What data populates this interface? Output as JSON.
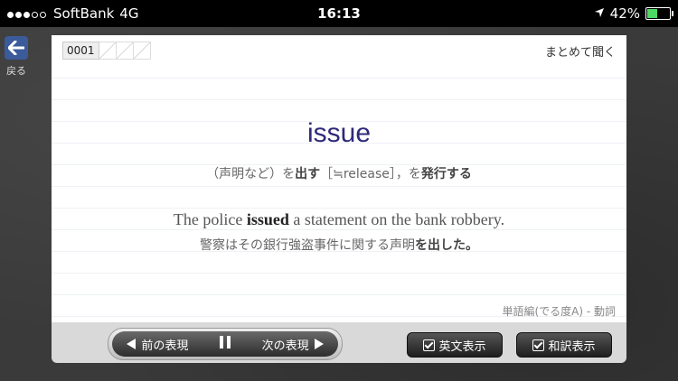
{
  "status_bar": {
    "carrier": "SoftBank",
    "network": "4G",
    "time": "16:13",
    "battery": "42%",
    "battery_level": 0.42,
    "location_icon": "location-arrow-icon"
  },
  "nav": {
    "back_label": "戻る",
    "back_icon": "arrow-left-icon"
  },
  "card": {
    "counter": "0001",
    "listen_all": "まとめて聞く",
    "word": "issue",
    "meaning_pre": "（声明など）を",
    "meaning_bold1": "出す",
    "meaning_mid": "［≒release］，を",
    "meaning_bold2": "発行する",
    "example_en_pre": "The police ",
    "example_en_bold": "issued",
    "example_en_post": " a statement on the bank robbery.",
    "example_ja_pre": "警察はその銀行強盗事件に関する声明",
    "example_ja_bold": "を出した。",
    "category": "単語編(でる度A) - 動詞"
  },
  "controls": {
    "prev_label": "前の表現",
    "next_label": "次の表現",
    "show_english": "英文表示",
    "show_japanese": "和訳表示"
  }
}
